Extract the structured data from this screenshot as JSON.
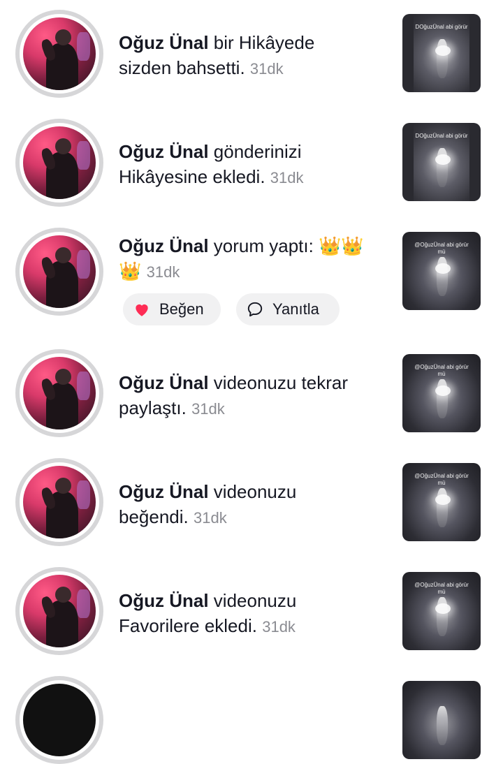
{
  "notifications": [
    {
      "name": "Oğuz Ünal",
      "line1_rest": " bir Hikâyede",
      "line2": "sizden bahsetti.",
      "time": "31dk",
      "thumb_caption": "DOğuzÜnal abi görür",
      "thumb_caption2": ""
    },
    {
      "name": "Oğuz Ünal",
      "line1_rest": " gönderinizi",
      "line2": "Hikâyesine ekledi.",
      "time": "31dk",
      "thumb_caption": "DOğuzÜnal abi görür",
      "thumb_caption2": ""
    },
    {
      "name": "Oğuz Ünal",
      "line1_rest": " yorum yaptı: 👑👑",
      "line2": "👑",
      "time": "31dk",
      "thumb_caption": "@OğuzÜnal abi görür",
      "thumb_caption2": "mü"
    },
    {
      "name": "Oğuz Ünal",
      "line1_rest": " videonuzu tekrar",
      "line2": "paylaştı.",
      "time": "31dk",
      "thumb_caption": "@OğuzÜnal abi görür",
      "thumb_caption2": "mü"
    },
    {
      "name": "Oğuz Ünal",
      "line1_rest": " videonuzu",
      "line2": "beğendi.",
      "time": "31dk",
      "thumb_caption": "@OğuzÜnal abi görür",
      "thumb_caption2": "mü"
    },
    {
      "name": "Oğuz Ünal",
      "line1_rest": " videonuzu",
      "line2": "Favorilere ekledi.",
      "time": "31dk",
      "thumb_caption": "@OğuzÜnal abi görür",
      "thumb_caption2": "mü"
    }
  ],
  "actions": {
    "like_label": "Beğen",
    "reply_label": "Yanıtla"
  },
  "icons": {
    "like": "heart-icon",
    "reply": "speech-bubble-icon"
  },
  "colors": {
    "like": "#fe2c55",
    "time": "#8a8b91",
    "pill_bg": "#f1f1f2"
  }
}
